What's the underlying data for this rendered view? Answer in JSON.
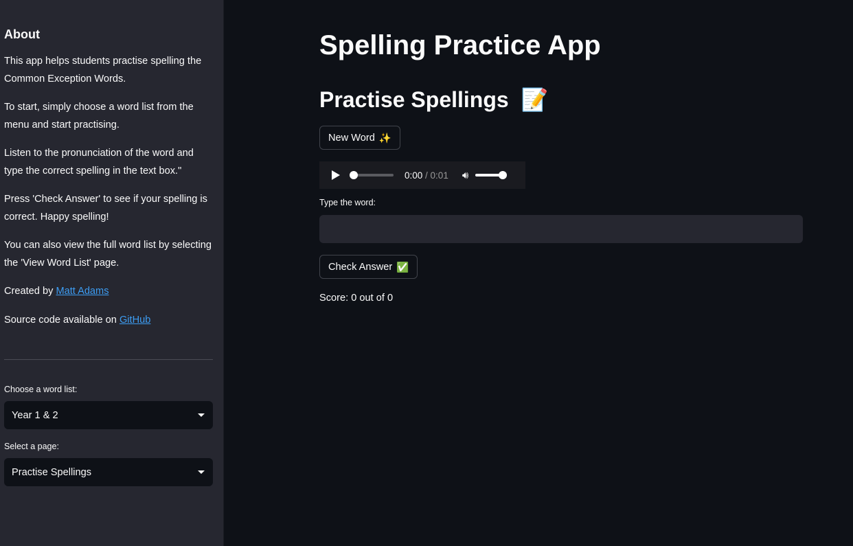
{
  "sidebar": {
    "heading": "About",
    "paragraphs": [
      "This app helps students practise spelling the Common Exception Words.",
      "To start, simply choose a word list from the menu and start practising.",
      "Listen to the pronunciation of the word and type the correct spelling in the text box.\"",
      "Press 'Check Answer' to see if your spelling is correct. Happy spelling!",
      "You can also view the full word list by selecting the 'View Word List' page."
    ],
    "created_by": "Created by ",
    "author_link": "Matt Adams",
    "source_text": "Source code available on ",
    "source_link": "GitHub",
    "word_list_label": "Choose a word list:",
    "word_list_value": "Year 1 & 2",
    "page_label": "Select a page:",
    "page_value": "Practise Spellings"
  },
  "main": {
    "title": "Spelling Practice App",
    "subtitle": "Practise Spellings",
    "subtitle_emoji": "📝",
    "new_word_label": "New Word",
    "new_word_emoji": "✨",
    "audio": {
      "current": "0:00",
      "duration": "/ 0:01",
      "progress": 0,
      "volume": 1.0
    },
    "input_label": "Type the word:",
    "input_value": "",
    "check_label": "Check Answer",
    "check_emoji": "✅",
    "score": "Score: 0 out of 0"
  }
}
